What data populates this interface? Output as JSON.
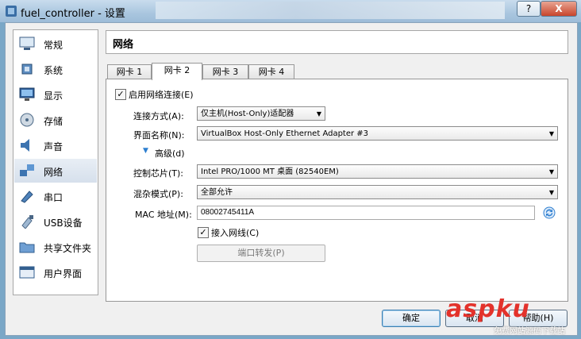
{
  "window": {
    "title": "fuel_controller - 设置",
    "help_label": "?",
    "close_label": "X"
  },
  "sidebar": {
    "items": [
      {
        "label": "常规",
        "icon": "general-icon"
      },
      {
        "label": "系统",
        "icon": "system-chip-icon"
      },
      {
        "label": "显示",
        "icon": "display-monitor-icon"
      },
      {
        "label": "存储",
        "icon": "storage-disk-icon"
      },
      {
        "label": "声音",
        "icon": "speaker-icon"
      },
      {
        "label": "网络",
        "icon": "network-icon"
      },
      {
        "label": "串口",
        "icon": "serial-port-icon"
      },
      {
        "label": "USB设备",
        "icon": "usb-icon"
      },
      {
        "label": "共享文件夹",
        "icon": "shared-folder-icon"
      },
      {
        "label": "用户界面",
        "icon": "user-interface-icon"
      }
    ],
    "selected": "网络"
  },
  "header": {
    "title": "网络"
  },
  "tabs": [
    {
      "label": "网卡 1"
    },
    {
      "label": "网卡 2"
    },
    {
      "label": "网卡 3"
    },
    {
      "label": "网卡 4"
    }
  ],
  "active_tab": "网卡 2",
  "adapter": {
    "enable_label": "启用网络连接(E)",
    "enable_checked": true,
    "attached_to_label": "连接方式(A):",
    "attached_to_value": "仅主机(Host-Only)适配器",
    "name_label": "界面名称(N):",
    "name_value": "VirtualBox Host-Only Ethernet Adapter #3",
    "advanced_label": "高级(d)",
    "adapter_type_label": "控制芯片(T):",
    "adapter_type_value": "Intel PRO/1000 MT 桌面 (82540EM)",
    "promiscuous_label": "混杂模式(P):",
    "promiscuous_value": "全部允许",
    "mac_label": "MAC 地址(M):",
    "mac_value": "08002745411A",
    "cable_label": "接入网线(C)",
    "cable_checked": true,
    "port_forwarding_label": "端口转发(P)"
  },
  "footer": {
    "ok_label": "确定",
    "cancel_label": "取消",
    "help_label": "帮助(H)"
  },
  "watermark": {
    "brand": "aspku",
    "subtitle": "免费网站源码下载站"
  },
  "colors": {
    "selection": "#d6e0ec",
    "watermark_red": "#e3322b",
    "refresh_blue": "#2f7fd0"
  }
}
